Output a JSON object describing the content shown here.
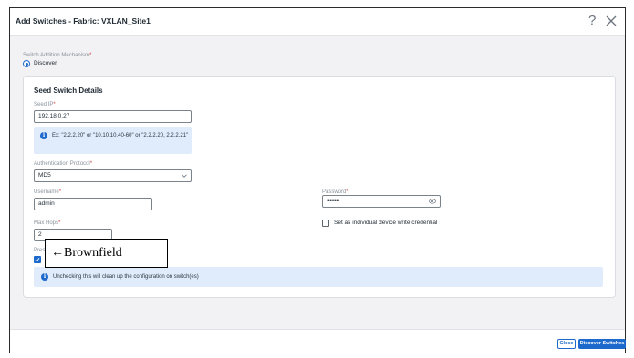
{
  "dialog": {
    "title": "Add Switches - Fabric: VXLAN_Site1",
    "help_icon": "question-icon",
    "close_icon": "close-icon"
  },
  "mechanism": {
    "label": "Switch Addition Mechanism",
    "required_mark": "*",
    "selected_option": "Discover"
  },
  "seed": {
    "title": "Seed Switch Details",
    "seed_ip": {
      "label": "Seed IP",
      "value": "192.18.0.27"
    },
    "seed_ip_hint": "Ex: \"2.2.2.20\" or \"10.10.10.40-60\" or \"2.2.2.20, 2.2.2.21\"",
    "auth_protocol": {
      "label": "Authentication Protocol",
      "value": "MD5"
    },
    "username": {
      "label": "Username",
      "value": "admin"
    },
    "password": {
      "label": "Password",
      "value": "••••••••"
    },
    "max_hops": {
      "label": "Max Hops",
      "value": "2"
    },
    "write_credential_label": "Set as individual device write credential",
    "preserve_label": "Pres",
    "preserve_checked": true,
    "preserve_info": "Unchecking this will clean up the configuration on switch(es)"
  },
  "annotation": {
    "text": "←Brownfield"
  },
  "footer": {
    "close_label": "Close",
    "discover_label": "Discover Switches"
  },
  "colors": {
    "accent": "#1d69cc",
    "info_bg": "#e0ecfb",
    "required": "#d63b3b"
  }
}
